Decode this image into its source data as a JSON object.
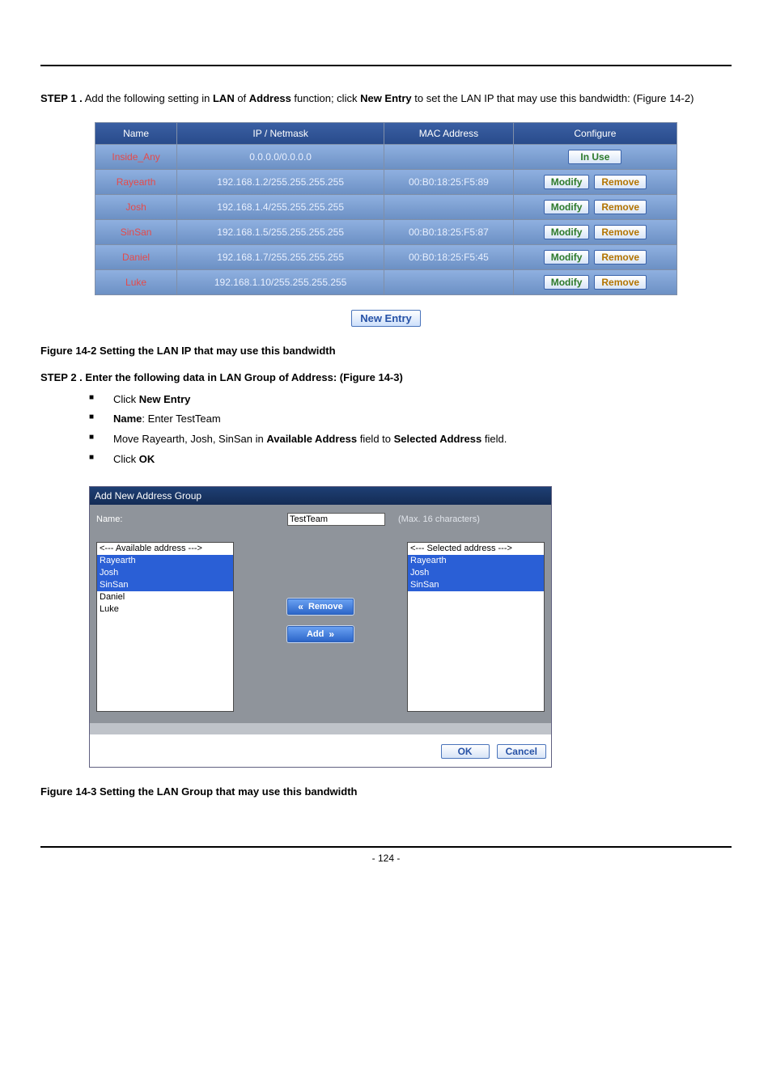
{
  "intro": "Add the following setting in LAN of Address function; click New Entry to set the LAN IP that may use this bandwidth: (Figure 14-2)",
  "table": {
    "headers": {
      "name": "Name",
      "ip": "IP / Netmask",
      "mac": "MAC Address",
      "cfg": "Configure"
    },
    "rows": [
      {
        "name": "Inside_Any",
        "ip": "0.0.0.0/0.0.0.0",
        "mac": "",
        "inuse": true
      },
      {
        "name": "Rayearth",
        "ip": "192.168.1.2/255.255.255.255",
        "mac": "00:B0:18:25:F5:89",
        "inuse": false
      },
      {
        "name": "Josh",
        "ip": "192.168.1.4/255.255.255.255",
        "mac": "",
        "inuse": false
      },
      {
        "name": "SinSan",
        "ip": "192.168.1.5/255.255.255.255",
        "mac": "00:B0:18:25:F5:87",
        "inuse": false
      },
      {
        "name": "Daniel",
        "ip": "192.168.1.7/255.255.255.255",
        "mac": "00:B0:18:25:F5:45",
        "inuse": false
      },
      {
        "name": "Luke",
        "ip": "192.168.1.10/255.255.255.255",
        "mac": "",
        "inuse": false
      }
    ],
    "buttons": {
      "inuse": "In  Use",
      "modify": "Modify",
      "remove": "Remove",
      "newentry": "New  Entry"
    }
  },
  "fig1_caption": "Figure 14-2 Setting the LAN IP that may use this bandwidth",
  "step2": {
    "heading": "STEP 2 . Enter the following data in LAN Group of Address: (Figure 14-3)",
    "bullets": [
      "Click New Entry",
      "Name: Enter TestTeam",
      "Move Rayearth, Josh, SinSan in Available Address field to Selected Address field.",
      "Click OK"
    ]
  },
  "group": {
    "title": "Add New Address Group",
    "name_label": "Name:",
    "name_value": "TestTeam",
    "name_hint": "(Max. 16 characters)",
    "available_header": "<--- Available address --->",
    "available": [
      "Rayearth",
      "Josh",
      "SinSan",
      "Daniel",
      "Luke"
    ],
    "available_selected_count": 3,
    "selected_header": "<--- Selected address --->",
    "selected": [
      "Rayearth",
      "Josh",
      "SinSan"
    ],
    "remove_label": "Remove",
    "add_label": "Add",
    "ok_label": "OK",
    "cancel_label": "Cancel"
  },
  "fig2_caption": "Figure 14-3 Setting the LAN Group that may use this bandwidth",
  "pagenum": "- 124 -"
}
